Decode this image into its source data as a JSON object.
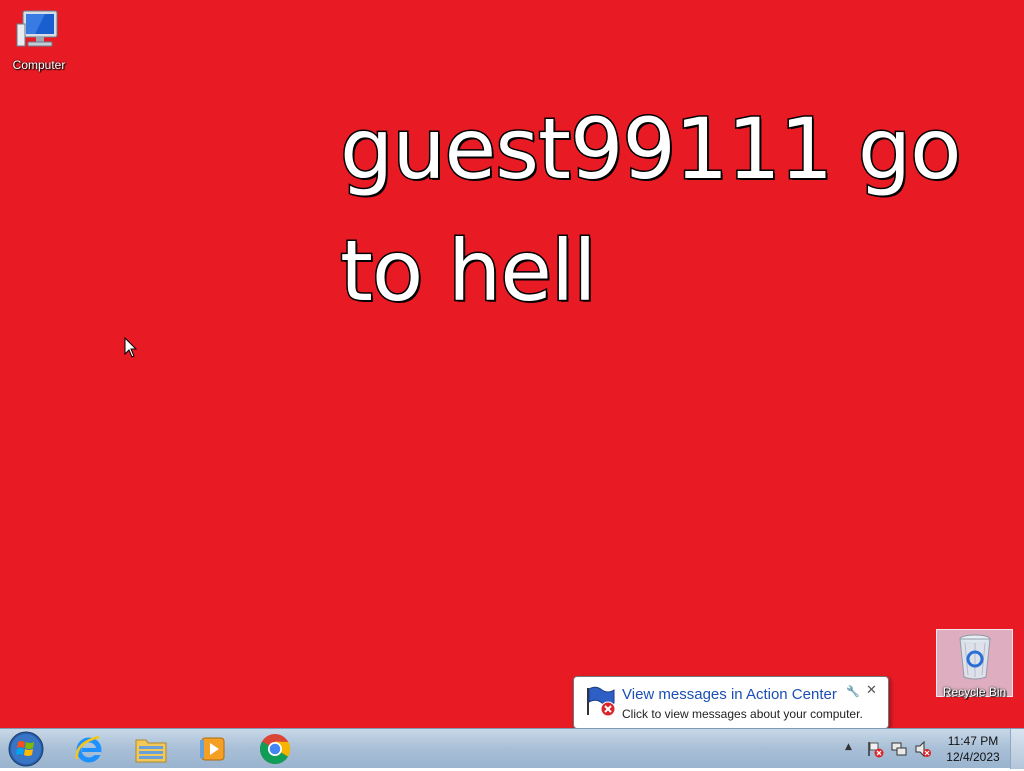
{
  "wallpaper": {
    "line1": "guest99111 go",
    "line2": "to hell",
    "background_color": "#e81b25"
  },
  "desktop_icons": [
    {
      "label": "Computer",
      "icon": "computer-icon"
    },
    {
      "label": "Recycle Bin",
      "icon": "recycle-bin-icon"
    }
  ],
  "notification": {
    "title": "View messages in Action Center",
    "message": "Click to view messages about your computer.",
    "icon": "action-center-flag-icon"
  },
  "taskbar": {
    "apps": [
      {
        "icon": "internet-explorer-icon"
      },
      {
        "icon": "file-explorer-icon"
      },
      {
        "icon": "media-player-icon"
      },
      {
        "icon": "chrome-icon"
      }
    ],
    "tray_icons": [
      "action-center-icon",
      "network-icon",
      "volume-muted-icon"
    ],
    "time": "11:47 PM",
    "date": "12/4/2023"
  }
}
